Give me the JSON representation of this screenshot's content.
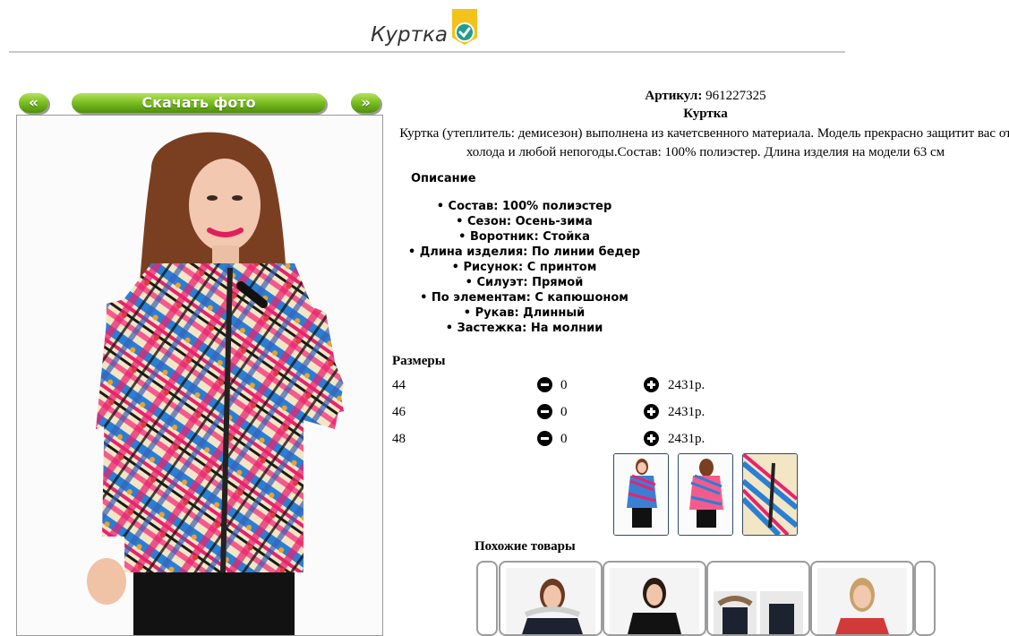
{
  "header": {
    "title": "Куртка",
    "badge_icon": "check-badge-icon"
  },
  "gallery": {
    "prev_label": "«",
    "download_label": "Скачать фото",
    "next_label": "»"
  },
  "product": {
    "article_label": "Артикул:",
    "article_value": "961227325",
    "name": "Куртка",
    "description": "Куртка (утеплитель: демисезон) выполнена из качетсвенного материала. Модель прекрасно защитит вас от холода и любой непогоды.Состав: 100% полиэстер. Длина изделия на модели 63 см",
    "features_heading": "Описание",
    "features": [
      "Состав: 100% полиэстер",
      "Сезон: Осень-зима",
      "Воротник: Стойка",
      "Длина изделия: По линии бедер",
      "Рисунок: С принтом",
      "Силуэт: Прямой",
      "По элементам: С капюшоном",
      "Рукав: Длинный",
      "Застежка: На молнии"
    ]
  },
  "sizes": {
    "heading": "Размеры",
    "rows": [
      {
        "size": "44",
        "qty": "0",
        "price": "2431р."
      },
      {
        "size": "46",
        "qty": "0",
        "price": "2431р."
      },
      {
        "size": "48",
        "qty": "0",
        "price": "2431р."
      }
    ]
  },
  "similar": {
    "heading": "Похожие товары"
  },
  "colors": {
    "button_green": "#6cb31a",
    "thumb_border": "#2e4a6a",
    "badge_yellow": "#f3c21b",
    "badge_teal": "#1f9e8e"
  }
}
